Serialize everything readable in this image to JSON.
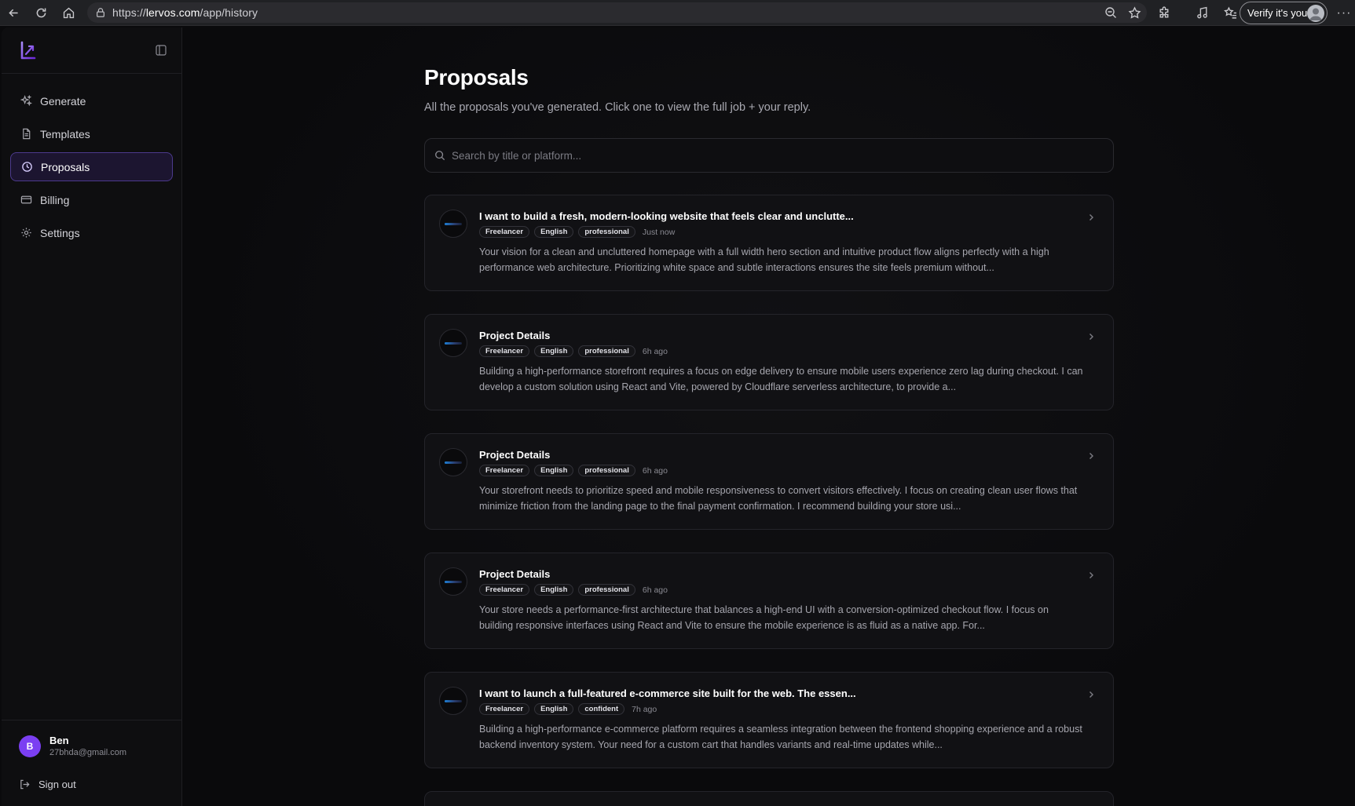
{
  "browser": {
    "url_prefix": "https://",
    "url_host": "lervos.com",
    "url_path": "/app/history",
    "verify_label": "Verify it's you",
    "more_label": "···"
  },
  "sidebar": {
    "items": [
      {
        "label": "Generate",
        "icon": "sparkles-icon",
        "active": false
      },
      {
        "label": "Templates",
        "icon": "document-icon",
        "active": false
      },
      {
        "label": "Proposals",
        "icon": "clock-icon",
        "active": true
      },
      {
        "label": "Billing",
        "icon": "credit-card-icon",
        "active": false
      },
      {
        "label": "Settings",
        "icon": "gear-icon",
        "active": false
      }
    ],
    "user": {
      "initial": "B",
      "name": "Ben",
      "email": "27bhda@gmail.com"
    },
    "signout_label": "Sign out"
  },
  "main": {
    "title": "Proposals",
    "subtitle": "All the proposals you've generated. Click one to view the full job + your reply.",
    "search": {
      "placeholder": "Search by title or platform...",
      "value": ""
    },
    "proposals": [
      {
        "title": "I want to build a fresh, modern-looking website that feels clear and unclutte...",
        "tags": [
          "Freelancer",
          "English",
          "professional"
        ],
        "time": "Just now",
        "excerpt": "Your vision for a clean and uncluttered homepage with a full width hero section and intuitive product flow aligns perfectly with a high performance web architecture. Prioritizing white space and subtle interactions ensures the site feels premium without..."
      },
      {
        "title": "Project Details",
        "tags": [
          "Freelancer",
          "English",
          "professional"
        ],
        "time": "6h ago",
        "excerpt": "Building a high-performance storefront requires a focus on edge delivery to ensure mobile users experience zero lag during checkout. I can develop a custom solution using React and Vite, powered by Cloudflare serverless architecture, to provide a..."
      },
      {
        "title": "Project Details",
        "tags": [
          "Freelancer",
          "English",
          "professional"
        ],
        "time": "6h ago",
        "excerpt": "Your storefront needs to prioritize speed and mobile responsiveness to convert visitors effectively. I focus on creating clean user flows that minimize friction from the landing page to the final payment confirmation. I recommend building your store usi..."
      },
      {
        "title": "Project Details",
        "tags": [
          "Freelancer",
          "English",
          "professional"
        ],
        "time": "6h ago",
        "excerpt": "Your store needs a performance-first architecture that balances a high-end UI with a conversion-optimized checkout flow. I focus on building responsive interfaces using React and Vite to ensure the mobile experience is as fluid as a native app. For..."
      },
      {
        "title": "I want to launch a full-featured e-commerce site built for the web. The essen...",
        "tags": [
          "Freelancer",
          "English",
          "confident"
        ],
        "time": "7h ago",
        "excerpt": "Building a high-performance e-commerce platform requires a seamless integration between the frontend shopping experience and a robust backend inventory system. Your need for a custom cart that handles variants and real-time updates while..."
      }
    ]
  },
  "colors": {
    "accent": "#7b3ff2",
    "active_nav_bg": "#1c1530",
    "active_nav_border": "#4c3a8d",
    "background": "#0a0a0c"
  }
}
